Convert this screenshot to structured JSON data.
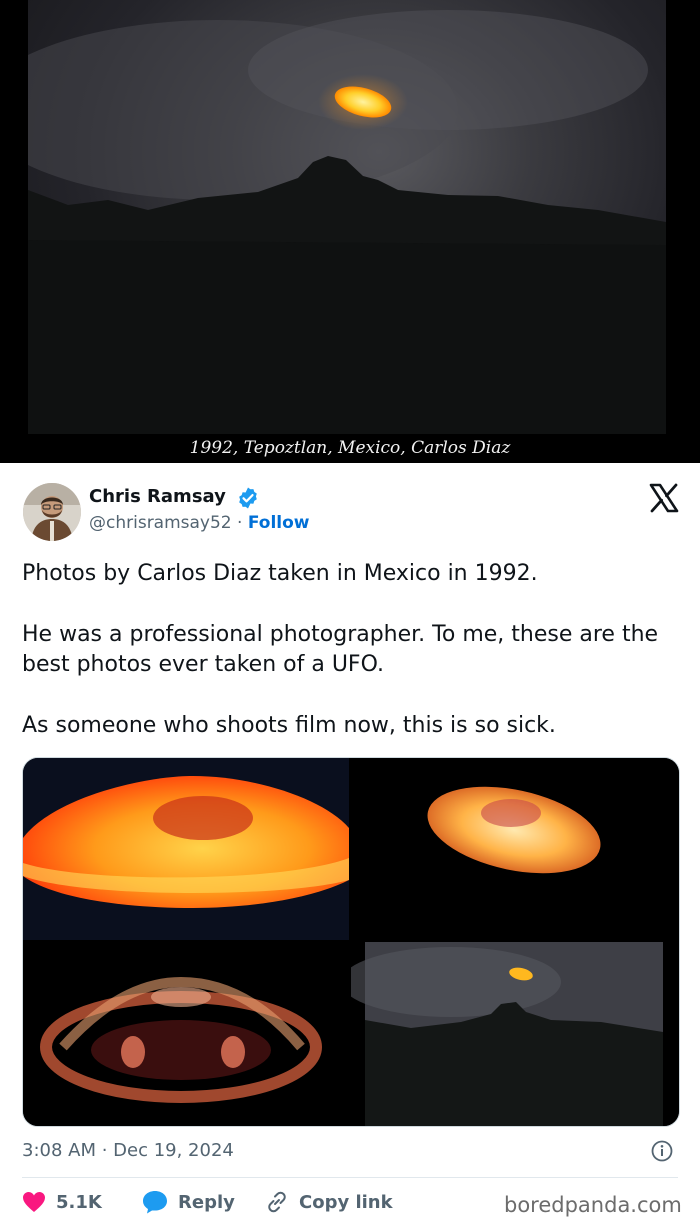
{
  "photo": {
    "caption": "1992, Tepoztlan, Mexico, Carlos Diaz"
  },
  "tweet": {
    "author_name": "Chris Ramsay",
    "handle": "@chrisramsay52",
    "separator": "·",
    "follow_label": "Follow",
    "paragraphs": [
      "Photos by Carlos Diaz taken in Mexico in 1992.",
      "He was a professional photographer. To me, these are the best photos ever taken of a UFO.",
      "As someone who shoots film now, this is so sick."
    ],
    "timestamp": "3:08 AM · Dec 19, 2024",
    "likes_count": "5.1K",
    "reply_label": "Reply",
    "copy_link_label": "Copy link"
  },
  "watermark": "boredpanda.com",
  "colors": {
    "accent_blue": "#006fd6",
    "verified_blue": "#1d9bf0",
    "like_pink": "#f91880",
    "text_primary": "#0f1419",
    "text_secondary": "#536471"
  },
  "icons": {
    "verified": "verified-badge-icon",
    "platform": "x-logo-icon",
    "info": "info-icon",
    "like": "heart-icon",
    "reply": "reply-bubble-icon",
    "copy_link": "link-icon"
  }
}
